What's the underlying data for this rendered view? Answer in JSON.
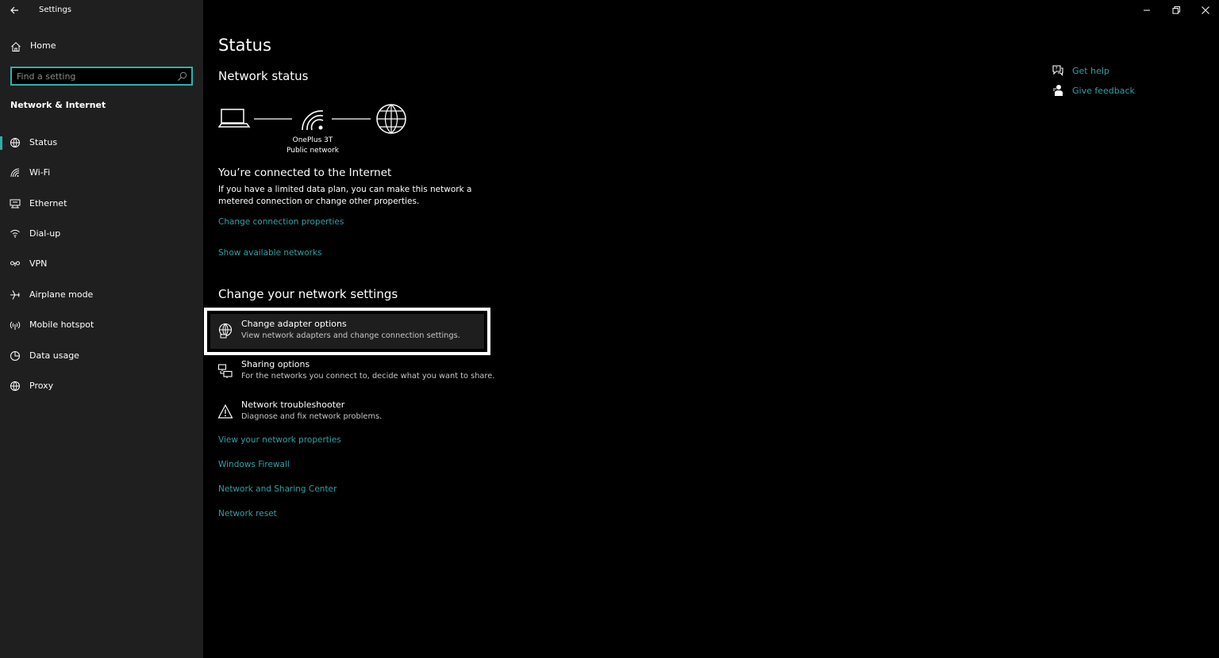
{
  "app": {
    "title": "Settings"
  },
  "sidebar": {
    "home_label": "Home",
    "search_placeholder": "Find a setting",
    "section_title": "Network & Internet",
    "items": [
      {
        "label": "Status",
        "icon": "status-icon",
        "active": true
      },
      {
        "label": "Wi-Fi",
        "icon": "wifi-icon"
      },
      {
        "label": "Ethernet",
        "icon": "ethernet-icon"
      },
      {
        "label": "Dial-up",
        "icon": "dialup-icon"
      },
      {
        "label": "VPN",
        "icon": "vpn-icon"
      },
      {
        "label": "Airplane mode",
        "icon": "airplane-icon"
      },
      {
        "label": "Mobile hotspot",
        "icon": "hotspot-icon"
      },
      {
        "label": "Data usage",
        "icon": "data-usage-icon"
      },
      {
        "label": "Proxy",
        "icon": "proxy-icon"
      }
    ]
  },
  "main": {
    "title": "Status",
    "network_status_heading": "Network status",
    "network_name": "OnePlus 3T",
    "network_type": "Public network",
    "connected_title": "You’re connected to the Internet",
    "connected_desc": "If you have a limited data plan, you can make this network a metered connection or change other properties.",
    "link_change_connection": "Change connection properties",
    "link_show_networks": "Show available networks",
    "change_settings_heading": "Change your network settings",
    "settings": [
      {
        "title": "Change adapter options",
        "desc": "View network adapters and change connection settings.",
        "icon": "adapter-icon"
      },
      {
        "title": "Sharing options",
        "desc": "For the networks you connect to, decide what you want to share.",
        "icon": "sharing-icon"
      },
      {
        "title": "Network troubleshooter",
        "desc": "Diagnose and fix network problems.",
        "icon": "warning-icon"
      }
    ],
    "links": [
      "View your network properties",
      "Windows Firewall",
      "Network and Sharing Center",
      "Network reset"
    ]
  },
  "help": {
    "get_help": "Get help",
    "give_feedback": "Give feedback"
  },
  "colors": {
    "accent": "#2fa0a5",
    "sidebar_bg": "#1f1f1f",
    "main_bg": "#000000"
  }
}
